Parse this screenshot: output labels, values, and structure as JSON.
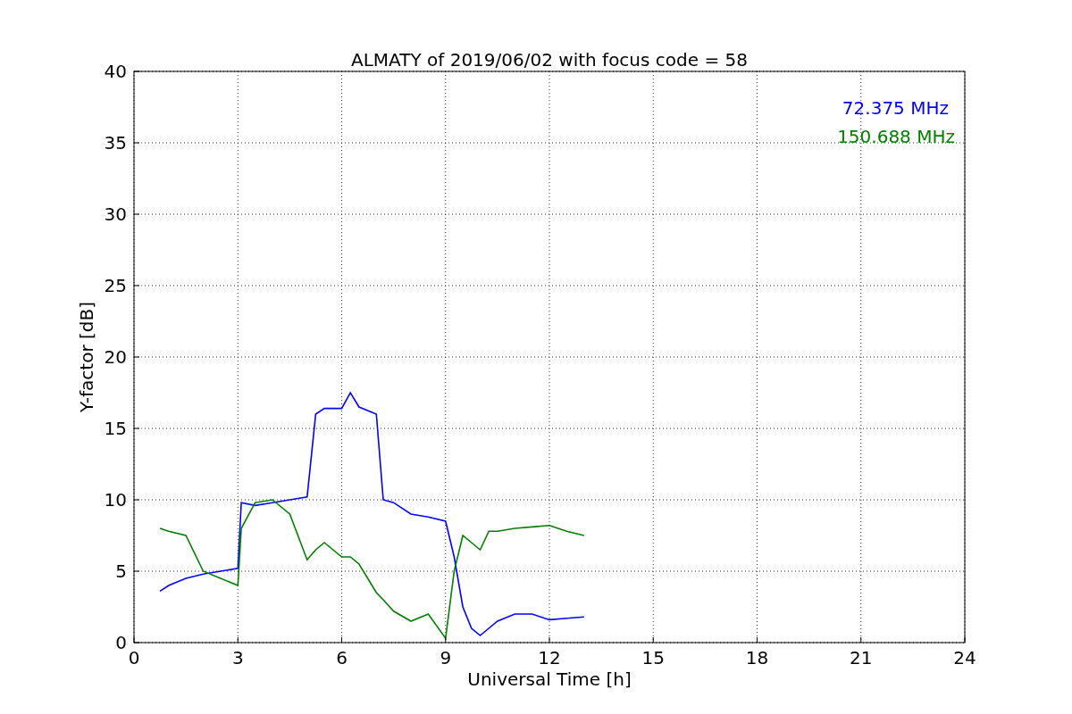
{
  "chart_data": {
    "type": "line",
    "title": "ALMATY of 2019/06/02 with focus code = 58",
    "xlabel": "Universal Time [h]",
    "ylabel": "Y-factor [dB]",
    "xlim": [
      0,
      24
    ],
    "ylim": [
      0,
      40
    ],
    "grid": true,
    "xticks": [
      0,
      3,
      6,
      9,
      12,
      15,
      18,
      21,
      24
    ],
    "yticks": [
      0,
      5,
      10,
      15,
      20,
      25,
      30,
      35,
      40
    ],
    "x": [
      0.75,
      1,
      1.5,
      2,
      2.5,
      3,
      3.1,
      3.5,
      4,
      4.5,
      5,
      5.25,
      5.5,
      6,
      6.25,
      6.5,
      7,
      7.2,
      7.5,
      8,
      8.5,
      9,
      9.25,
      9.5,
      9.75,
      10,
      10.25,
      10.5,
      11,
      11.5,
      12,
      12.5,
      13
    ],
    "series": [
      {
        "name": "72.375 MHz",
        "color": "#0000ff",
        "values": [
          3.6,
          4,
          4.5,
          4.8,
          5,
          5.2,
          9.8,
          9.6,
          9.8,
          10,
          10.2,
          16,
          16.4,
          16.4,
          17.5,
          16.5,
          16,
          10,
          9.8,
          9,
          8.8,
          8.5,
          6,
          2.5,
          1,
          0.5,
          1,
          1.5,
          2,
          2,
          1.6,
          1.7,
          1.8
        ]
      },
      {
        "name": "150.688 MHz",
        "color": "#008000",
        "values": [
          8,
          7.8,
          7.5,
          5,
          4.5,
          4,
          8,
          9.8,
          10,
          9,
          5.8,
          6.5,
          7,
          6,
          6,
          5.5,
          3.5,
          3,
          2.2,
          1.5,
          2,
          0.3,
          5,
          7.5,
          7,
          6.5,
          7.8,
          7.8,
          8,
          8.1,
          8.2,
          7.8,
          7.5
        ]
      }
    ]
  }
}
